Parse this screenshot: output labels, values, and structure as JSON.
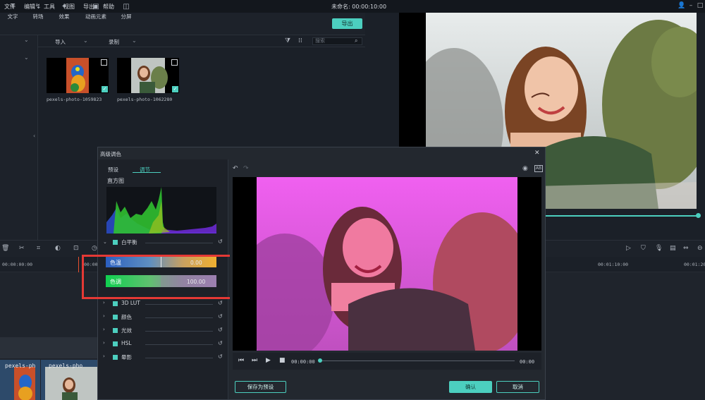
{
  "menu": {
    "items": [
      "文件",
      "编辑",
      "工具",
      "视图",
      "导出",
      "帮助"
    ]
  },
  "project": {
    "title": "未命名: 00:00:10:00"
  },
  "toolbar": {
    "tools": [
      {
        "label": "文字",
        "icon": "text-icon"
      },
      {
        "label": "转场",
        "icon": "transition-icon"
      },
      {
        "label": "效果",
        "icon": "effects-icon"
      },
      {
        "label": "动画元素",
        "icon": "elements-icon"
      },
      {
        "label": "分屏",
        "icon": "split-screen-icon"
      }
    ],
    "export_label": "导出"
  },
  "media": {
    "import_label": "导入",
    "record_label": "录制",
    "search_placeholder": "搜索",
    "items": [
      {
        "label": "pexels-photo-1059823"
      },
      {
        "label": "pexels-photo-1062280"
      }
    ]
  },
  "timeline": {
    "timecodes": [
      "00:00:00:00",
      "00:00:10",
      "00:01:10:00",
      "00:01:20:0"
    ],
    "clips": [
      "pexels-ph",
      "pexels-pho"
    ]
  },
  "dialog": {
    "title": "高级调色",
    "tabs": [
      "预设",
      "调节"
    ],
    "histogram_label": "直方图",
    "white_balance_label": "白平衡",
    "temperature": {
      "label": "色温",
      "value": "0.00"
    },
    "tint": {
      "label": "色调",
      "value": "100.00"
    },
    "sections": [
      "3D LUT",
      "颜色",
      "光效",
      "HSL",
      "晕影"
    ],
    "time_current": "00:00:00",
    "time_end": "00:00",
    "save_preset_label": "保存为预设",
    "ok_label": "确认",
    "cancel_label": "取消"
  },
  "colors": {
    "accent": "#4ccfbf",
    "highlight_box": "#e53935"
  }
}
